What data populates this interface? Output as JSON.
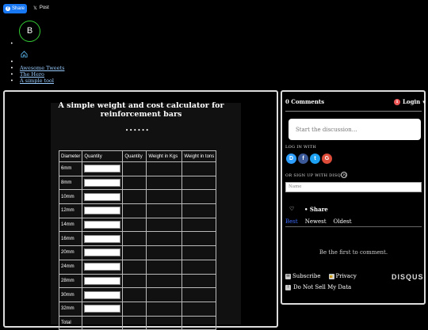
{
  "share": {
    "facebook_label": "Share",
    "x_label": "Post"
  },
  "logo": {
    "letter": "B"
  },
  "nav": {
    "items": [
      "Awesome Tweets",
      "The Hero",
      "A simple tool"
    ]
  },
  "page": {
    "title": "A simple weight and cost calculator for reinforcement bars",
    "loading_dots": "••••••"
  },
  "table": {
    "headers": [
      "Diameter",
      "Quantity",
      "Quantity",
      "Weight in Kgs",
      "Weight in tons"
    ],
    "rows": [
      "6mm",
      "8mm",
      "10mm",
      "12mm",
      "14mm",
      "16mm",
      "20mm",
      "24mm",
      "28mm",
      "30mm",
      "32mm"
    ],
    "partial_label": "Total"
  },
  "disqus": {
    "comments_count": "0 Comments",
    "notification_count": "1",
    "login_label": "Login",
    "discussion_placeholder": "Start the discussion…",
    "log_in_with": "LOG IN WITH",
    "or_sign_up": "OR SIGN UP WITH DISQUS",
    "name_placeholder": "Name",
    "share_label": "Share",
    "sort_best": "Best",
    "sort_newest": "Newest",
    "sort_oldest": "Oldest",
    "empty_message": "Be the first to comment.",
    "subscribe_label": "Subscribe",
    "privacy_label": "Privacy",
    "do_not_sell_label": "Do Not Sell My Data",
    "brand": "DISQUS"
  },
  "colors": {
    "accent": "#3d6bff",
    "logo_ring": "#33cc33",
    "facebook": "#1877f2"
  }
}
